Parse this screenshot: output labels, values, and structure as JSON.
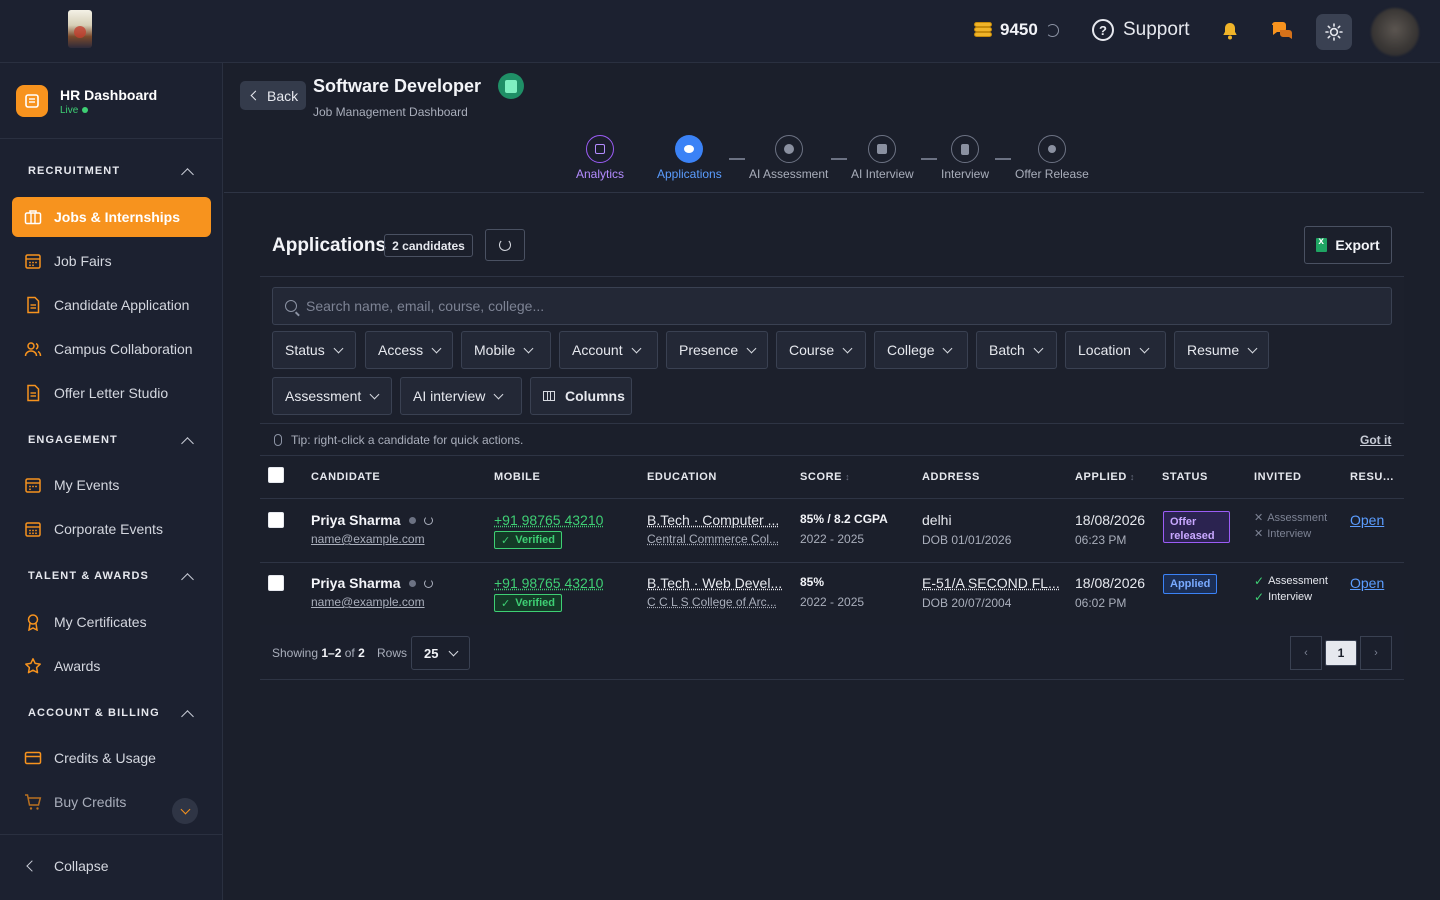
{
  "header": {
    "credits_value": "9450",
    "support_label": "Support",
    "icons": [
      "coins-icon",
      "history-icon",
      "help-icon",
      "bell-icon",
      "chat-icon",
      "sun-icon",
      "avatar"
    ],
    "colors": {
      "bell": "#f0b429",
      "chat": "#f7931e"
    }
  },
  "sidebar": {
    "brand_title": "HR Dashboard",
    "brand_status": "Live",
    "sections": [
      {
        "title": "RECRUITMENT",
        "items": [
          {
            "label": "Jobs & Internships",
            "icon": "briefcase-icon",
            "active": true
          },
          {
            "label": "Job Fairs",
            "icon": "calendar-icon"
          },
          {
            "label": "Candidate Application",
            "icon": "document-icon"
          },
          {
            "label": "Campus Collaboration",
            "icon": "users-icon"
          },
          {
            "label": "Offer Letter Studio",
            "icon": "document-icon"
          }
        ]
      },
      {
        "title": "ENGAGEMENT",
        "items": [
          {
            "label": "My Events",
            "icon": "calendar-icon"
          },
          {
            "label": "Corporate Events",
            "icon": "calendar-icon"
          }
        ]
      },
      {
        "title": "TALENT & AWARDS",
        "items": [
          {
            "label": "My Certificates",
            "icon": "ribbon-icon"
          },
          {
            "label": "Awards",
            "icon": "star-icon"
          }
        ]
      },
      {
        "title": "ACCOUNT & BILLING",
        "items": [
          {
            "label": "Credits & Usage",
            "icon": "card-icon"
          },
          {
            "label": "Buy Credits",
            "icon": "cart-icon"
          }
        ]
      }
    ],
    "collapse_label": "Collapse",
    "accent_color": "#f7931e"
  },
  "job": {
    "back_label": "Back",
    "title": "Software Developer",
    "subtitle": "Job Management Dashboard"
  },
  "steps": [
    {
      "label": "Analytics",
      "icon": "chart-icon"
    },
    {
      "label": "Applications",
      "icon": "group-icon"
    },
    {
      "label": "AI Assessment",
      "icon": "brain-icon"
    },
    {
      "label": "AI Interview",
      "icon": "video-icon"
    },
    {
      "label": "Interview",
      "icon": "clipboard-icon"
    },
    {
      "label": "Offer Release",
      "icon": "award-icon"
    }
  ],
  "applications": {
    "title": "Applications",
    "count_label": "2 candidates",
    "export_label": "Export",
    "search_placeholder": "Search name, email, course, college...",
    "filters": [
      "Status",
      "Access",
      "Mobile",
      "Account",
      "Presence",
      "Course",
      "College",
      "Batch",
      "Location",
      "Resume",
      "Assessment",
      "AI interview"
    ],
    "columns_label": "Columns",
    "tip": "Tip: right-click a candidate for quick actions.",
    "got_it": "Got it"
  },
  "table": {
    "headers": {
      "candidate": "CANDIDATE",
      "mobile": "MOBILE",
      "education": "EDUCATION",
      "score": "SCORE",
      "address": "ADDRESS",
      "applied": "APPLIED",
      "status": "STATUS",
      "invited": "INVITED",
      "resume": "RESU..."
    },
    "rows": [
      {
        "name": "Priya Sharma",
        "email": "name@example.com",
        "mobile": "+91 98765 43210",
        "verified": "Verified",
        "education": "B.Tech · Computer ...",
        "college": "Central Commerce Col...",
        "score": "85% / 8.2 CGPA",
        "years": "2022 - 2025",
        "address": "delhi",
        "dob": "DOB 01/01/2026",
        "applied_date": "18/08/2026",
        "applied_time": "06:23 PM",
        "status": "Offer released",
        "invited": [
          {
            "label": "Assessment",
            "done": false
          },
          {
            "label": "Interview",
            "done": false
          }
        ],
        "resume": "Open"
      },
      {
        "name": "Priya Sharma",
        "email": "name@example.com",
        "mobile": "+91 98765 43210",
        "verified": "Verified",
        "education": "B.Tech · Web Devel...",
        "college": "C C L S College of Arc...",
        "score": "85%",
        "years": "2022 - 2025",
        "address": "E-51/A SECOND FL...",
        "dob": "DOB 20/07/2004",
        "applied_date": "18/08/2026",
        "applied_time": "06:02 PM",
        "status": "Applied",
        "invited": [
          {
            "label": "Assessment",
            "done": true
          },
          {
            "label": "Interview",
            "done": true
          }
        ],
        "resume": "Open"
      }
    ]
  },
  "pagination": {
    "showing_prefix": "Showing",
    "showing_range": "1–2",
    "showing_of": "of",
    "showing_total": "2",
    "rows_label": "Rows",
    "rows_value": "25",
    "prev": "‹",
    "current_page": "1",
    "next": "›"
  }
}
